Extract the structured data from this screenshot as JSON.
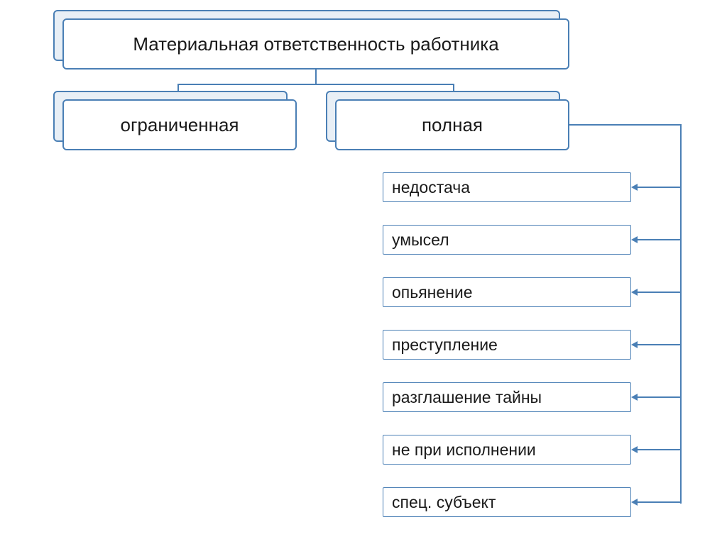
{
  "root": {
    "title": "Материальная ответственность работника"
  },
  "branches": {
    "left": "ограниченная",
    "right": "полная"
  },
  "details": [
    "недостача",
    "умысел",
    "опьянение",
    "преступление",
    "разглашение тайны",
    "не при исполнении",
    "спец. субъект"
  ]
}
